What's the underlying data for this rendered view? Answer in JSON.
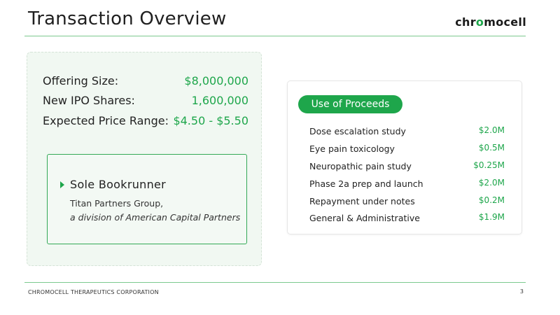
{
  "header": {
    "title": "Transaction Overview",
    "logo_pre": "chr",
    "logo_accent": "o",
    "logo_post": "mocell"
  },
  "offering": [
    {
      "label": "Offering Size:",
      "value": "$8,000,000"
    },
    {
      "label": "New IPO Shares:",
      "value": "1,600,000"
    },
    {
      "label": "Expected Price Range:",
      "value": "$4.50 - $5.50"
    }
  ],
  "bookrunner": {
    "title": "Sole Bookrunner",
    "line1": "Titan Partners Group,",
    "line2": "a division of American Capital Partners"
  },
  "proceeds": {
    "title": "Use of Proceeds",
    "items": [
      {
        "label": "Dose escalation study",
        "value": "$2.0M"
      },
      {
        "label": "Eye pain toxicology",
        "value": "$0.5M"
      },
      {
        "label": "Neuropathic pain study",
        "value": "$0.25M"
      },
      {
        "label": "Phase 2a prep and launch",
        "value": "$2.0M"
      },
      {
        "label": "Repayment under notes",
        "value": "$0.2M"
      },
      {
        "label": "General & Administrative",
        "value": "$1.9M"
      }
    ]
  },
  "footer": {
    "company": "CHROMOCELL THERAPEUTICS CORPORATION",
    "page": "3"
  },
  "colors": {
    "accent": "#1ea64b",
    "panel_bg": "#f1f8f2"
  }
}
